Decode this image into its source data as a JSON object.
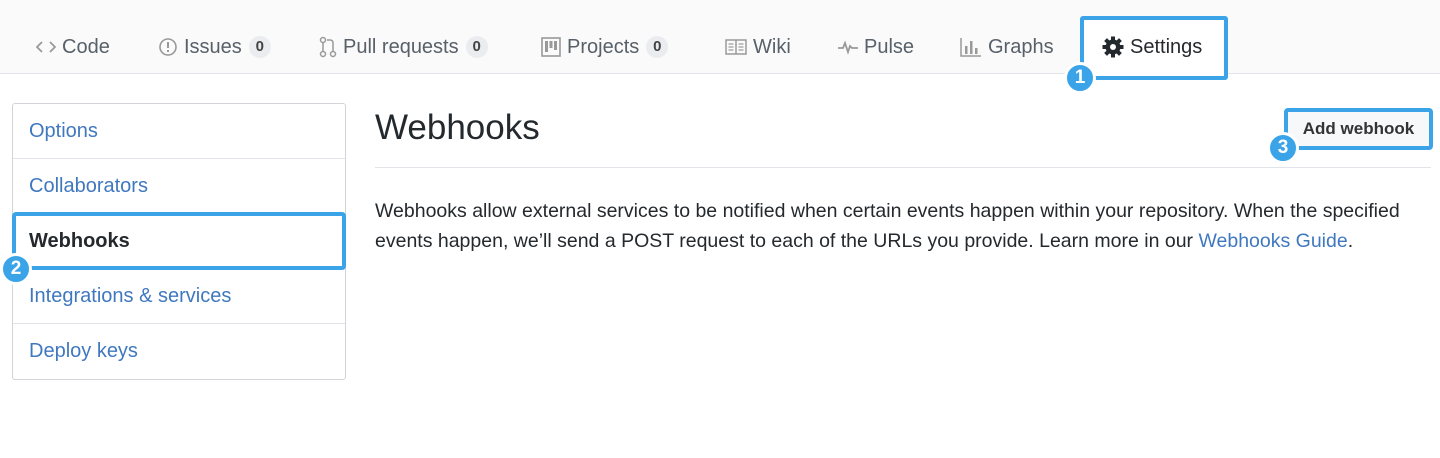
{
  "tabs": [
    {
      "label": "Code",
      "icon": "code-icon"
    },
    {
      "label": "Issues",
      "icon": "issue-icon",
      "count": "0"
    },
    {
      "label": "Pull requests",
      "icon": "pull-request-icon",
      "count": "0"
    },
    {
      "label": "Projects",
      "icon": "project-icon",
      "count": "0"
    },
    {
      "label": "Wiki",
      "icon": "book-icon"
    },
    {
      "label": "Pulse",
      "icon": "pulse-icon"
    },
    {
      "label": "Graphs",
      "icon": "graph-icon"
    },
    {
      "label": "Settings",
      "icon": "gear-icon",
      "selected": true
    }
  ],
  "callouts": [
    "1",
    "2",
    "3"
  ],
  "sidebar": {
    "items": [
      {
        "label": "Options"
      },
      {
        "label": "Collaborators"
      },
      {
        "label": "Webhooks",
        "selected": true
      },
      {
        "label": "Integrations & services"
      },
      {
        "label": "Deploy keys"
      }
    ]
  },
  "main": {
    "title": "Webhooks",
    "add_button": "Add webhook",
    "description_text": "Webhooks allow external services to be notified when certain events happen within your repository. When the specified events happen, we’ll send a POST request to each of the URLs you provide. Learn more in our ",
    "guide_link": "Webhooks Guide",
    "description_end": "."
  },
  "colors": {
    "accent_highlight": "#3ba4e8",
    "link": "#4078c0",
    "text": "#24292e"
  }
}
